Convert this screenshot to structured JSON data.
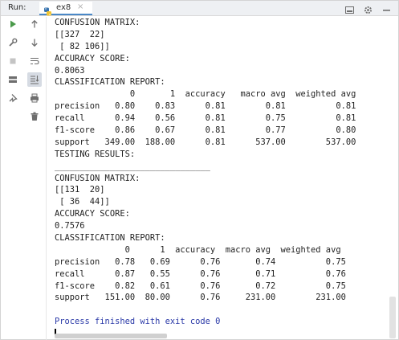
{
  "header": {
    "run_label": "Run:",
    "tab_title": "ex8",
    "tab_close": "×"
  },
  "console": {
    "lines": [
      "CONFUSION MATRIX:",
      "[[327  22]",
      " [ 82 106]]",
      "ACCURACY SCORE:",
      "0.8063",
      "CLASSIFICATION REPORT:",
      "               0       1  accuracy   macro avg  weighted avg",
      "precision   0.80    0.83      0.81        0.81          0.81",
      "recall      0.94    0.56      0.81        0.75          0.81",
      "f1-score    0.86    0.67      0.81        0.77          0.80",
      "support   349.00  188.00      0.81      537.00        537.00",
      "TESTING RESULTS:",
      "_______________________________",
      "CONFUSION MATRIX:",
      "[[131  20]",
      " [ 36  44]]",
      "ACCURACY SCORE:",
      "0.7576",
      "CLASSIFICATION REPORT:",
      "              0      1  accuracy  macro avg  weighted avg",
      "precision   0.78   0.69      0.76       0.74          0.75",
      "recall      0.87   0.55      0.76       0.71          0.76",
      "f1-score    0.82   0.61      0.76       0.72          0.75",
      "support   151.00  80.00      0.76     231.00        231.00",
      "",
      "Process finished with exit code 0"
    ]
  },
  "colors": {
    "run_green": "#4a9a4a",
    "process_blue": "#2b3aa8",
    "icon_gray": "#6e6e6e",
    "tab_underline": "#4a88c7"
  },
  "icons": {
    "left_col_1": [
      "run-icon",
      "wrench-icon",
      "stop-icon",
      "layout-icon",
      "pin-icon"
    ],
    "left_col_2": [
      "arrow-up-icon",
      "arrow-down-icon",
      "soft-wrap-icon",
      "scroll-to-end-icon",
      "print-icon",
      "trash-icon"
    ],
    "header_right": [
      "minimize-icon",
      "settings-icon",
      "hide-icon"
    ]
  }
}
